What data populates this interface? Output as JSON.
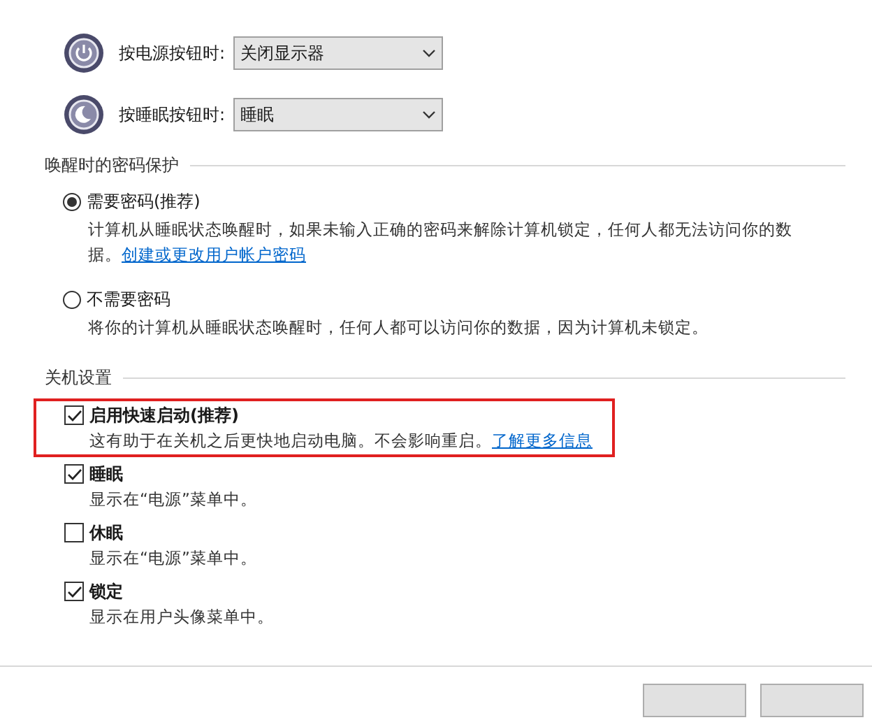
{
  "button_settings": [
    {
      "kind": "power",
      "label": "按电源按钮时:",
      "value": "关闭显示器"
    },
    {
      "kind": "sleep",
      "label": "按睡眠按钮时:",
      "value": "睡眠"
    }
  ],
  "password_section": {
    "heading": "唤醒时的密码保护",
    "options": [
      {
        "label": "需要密码(推荐)",
        "selected": true,
        "description": "计算机从睡眠状态唤醒时，如果未输入正确的密码来解除计算机锁定，任何人都无法访问你的数据。",
        "link": "创建或更改用户帐户密码"
      },
      {
        "label": "不需要密码",
        "selected": false,
        "description": "将你的计算机从睡眠状态唤醒时，任何人都可以访问你的数据，因为计算机未锁定。"
      }
    ]
  },
  "shutdown_section": {
    "heading": "关机设置",
    "options": [
      {
        "label": "启用快速启动(推荐)",
        "checked": true,
        "highlighted": true,
        "description": "这有助于在关机之后更快地启动电脑。不会影响重启。",
        "link": "了解更多信息"
      },
      {
        "label": "睡眠",
        "checked": true,
        "highlighted": false,
        "description": "显示在“电源”菜单中。"
      },
      {
        "label": "休眠",
        "checked": false,
        "highlighted": false,
        "description": "显示在“电源”菜单中。"
      },
      {
        "label": "锁定",
        "checked": true,
        "highlighted": false,
        "description": "显示在用户头像菜单中。"
      }
    ]
  }
}
